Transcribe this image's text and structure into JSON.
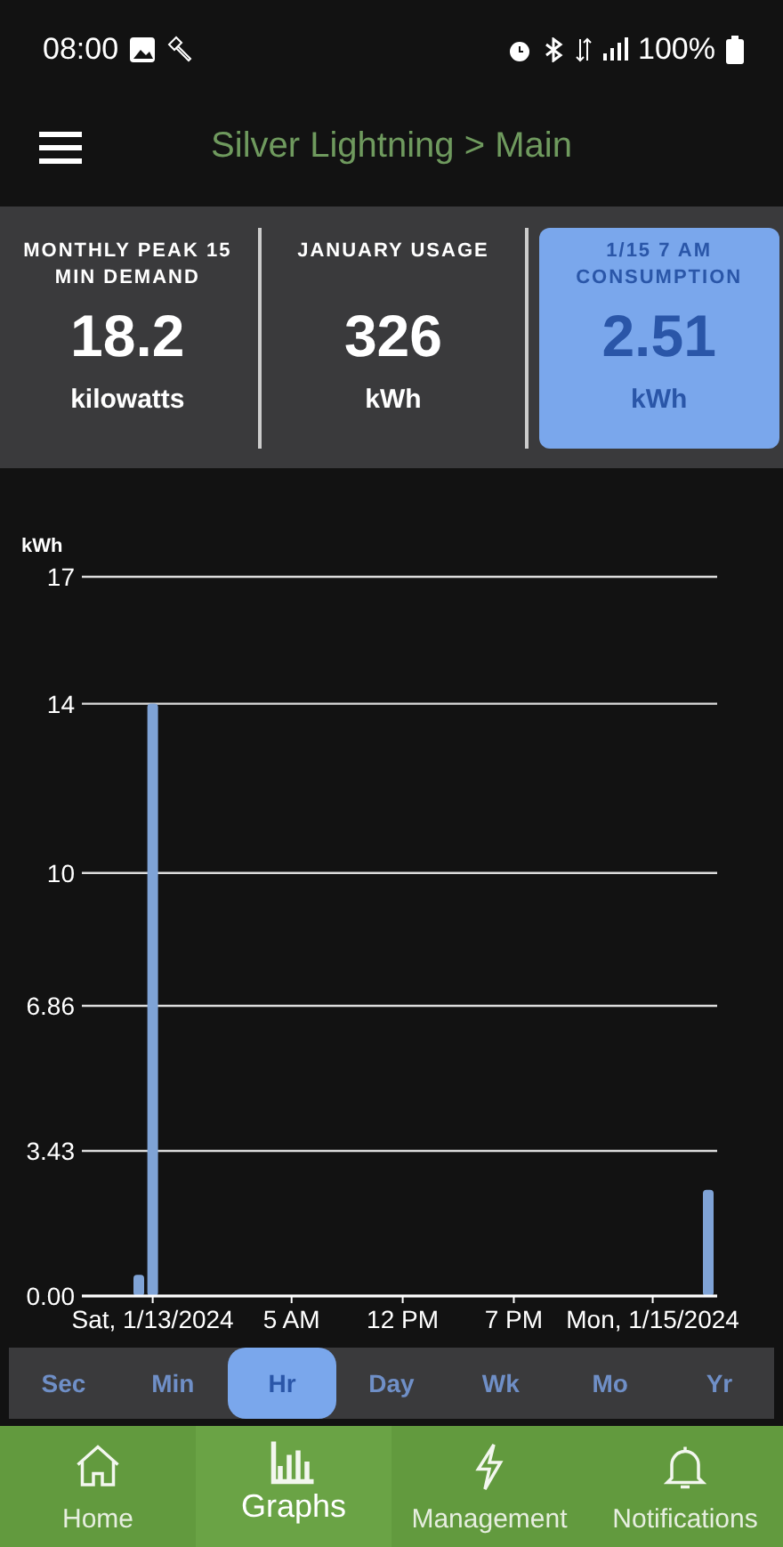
{
  "status_bar": {
    "time": "08:00",
    "battery": "100%"
  },
  "header": {
    "title": "Silver Lightning > Main"
  },
  "stats": [
    {
      "label": "MONTHLY PEAK 15 MIN DEMAND",
      "value": "18.2",
      "unit": "kilowatts",
      "selected": false
    },
    {
      "label": "JANUARY USAGE",
      "value": "326",
      "unit": "kWh",
      "selected": false
    },
    {
      "label": "1/15 7 AM CONSUMPTION",
      "value": "2.51",
      "unit": "kWh",
      "selected": true
    }
  ],
  "chart": {
    "chart_data": {
      "type": "bar",
      "grid": true,
      "ylabel": "kWh",
      "categories": [
        null,
        "Sat, 1/13/2024",
        null,
        null,
        null,
        null,
        null,
        null,
        null,
        null,
        null,
        "5 AM",
        null,
        null,
        null,
        null,
        null,
        null,
        null,
        "12 PM",
        null,
        null,
        null,
        null,
        null,
        null,
        null,
        "7 PM",
        null,
        null,
        null,
        null,
        null,
        null,
        null,
        null,
        null,
        "Mon, 1/15/2024",
        null,
        null,
        null,
        null
      ],
      "values": [
        0.5,
        14,
        null,
        null,
        null,
        null,
        null,
        null,
        null,
        null,
        null,
        null,
        null,
        null,
        null,
        null,
        null,
        null,
        null,
        null,
        null,
        null,
        null,
        null,
        null,
        null,
        null,
        null,
        null,
        null,
        null,
        null,
        null,
        null,
        null,
        null,
        null,
        null,
        null,
        null,
        null,
        2.51
      ],
      "ylim": [
        0,
        17
      ],
      "yticks": [
        {
          "value": 0,
          "label": "0.00"
        },
        {
          "value": 3.43,
          "label": "3.43"
        },
        {
          "value": 6.86,
          "label": "6.86"
        },
        {
          "value": 10,
          "label": "10"
        },
        {
          "value": 14,
          "label": "14"
        },
        {
          "value": 17,
          "label": "17"
        }
      ]
    }
  },
  "ranges": [
    {
      "label": "Sec",
      "selected": false
    },
    {
      "label": "Min",
      "selected": false
    },
    {
      "label": "Hr",
      "selected": true
    },
    {
      "label": "Day",
      "selected": false
    },
    {
      "label": "Wk",
      "selected": false
    },
    {
      "label": "Mo",
      "selected": false
    },
    {
      "label": "Yr",
      "selected": false
    }
  ],
  "nav": [
    {
      "label": "Home",
      "kind": "home",
      "selected": false
    },
    {
      "label": "Graphs",
      "kind": "graphs",
      "selected": true
    },
    {
      "label": "Management",
      "kind": "management",
      "selected": false
    },
    {
      "label": "Notifications",
      "kind": "notifications",
      "selected": false
    }
  ]
}
